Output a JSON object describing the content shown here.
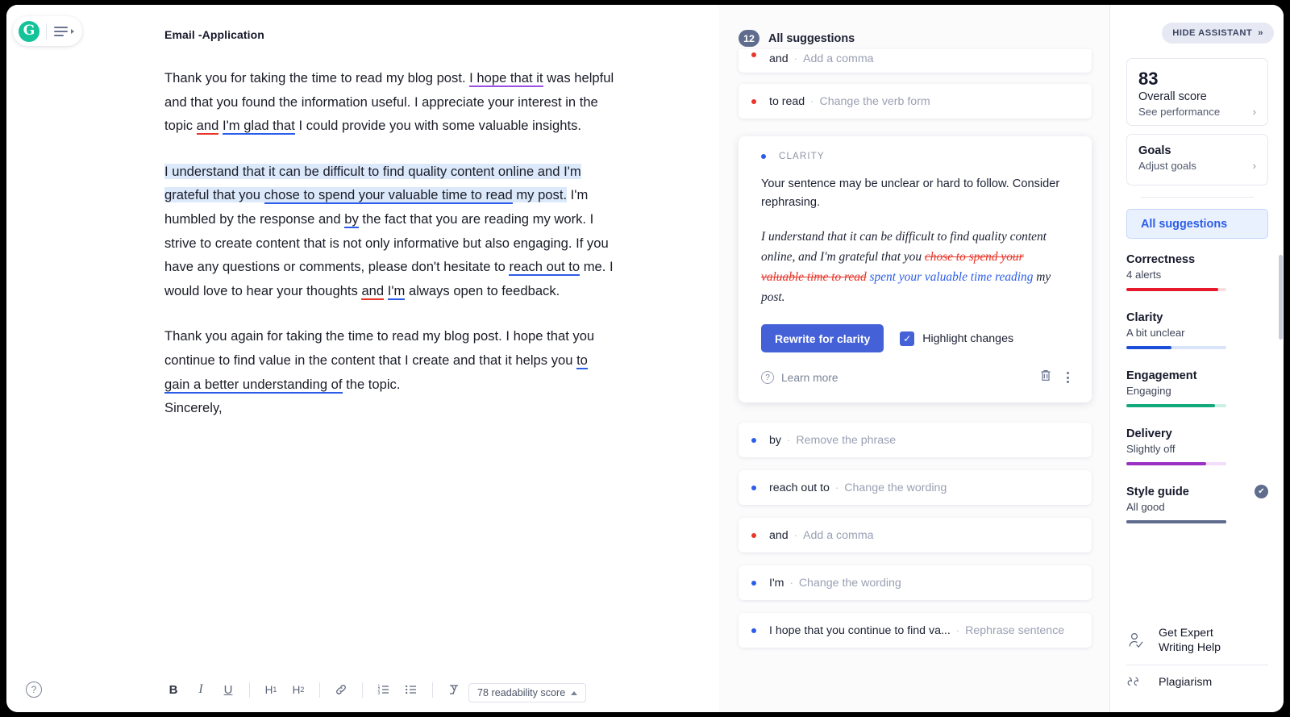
{
  "app": {
    "logo_letter": "G",
    "menu_icon": "hamburger-icon"
  },
  "document": {
    "title": "Email -Application",
    "paragraphs": [
      "Thank you for taking the time to read my blog post. I hope that it was helpful and that you found the information useful. I appreciate your interest in the topic and I'm glad that I could provide you with some valuable insights.",
      "I understand that it can be difficult to find quality content online and I'm grateful that you chose to spend your valuable time to read my post. I'm humbled by the response and by the fact that you are reading my work. I strive to create content that is not only informative but also engaging. If you have any questions or comments, please don't hesitate to reach out to me. I would love to hear your thoughts and I'm always open to feedback.",
      "Thank you again for taking the time to read my blog post. I hope that you continue to find value in the content that I create and that it helps you to gain a better understanding of the topic.",
      "Sincerely,"
    ]
  },
  "toolbar": {
    "bold": "B",
    "italic": "I",
    "underline": "U",
    "h1": "H",
    "h1_sub": "1",
    "h2": "H",
    "h2_sub": "2",
    "link_icon": "link-icon",
    "ordered_list_icon": "ordered-list-icon",
    "bullet_list_icon": "bullet-list-icon",
    "clear_format_icon": "clear-formatting-icon",
    "readability": "78 readability score",
    "help_icon": "?"
  },
  "suggestions": {
    "count": "12",
    "title": "All suggestions",
    "items": [
      {
        "target": "and",
        "sep": "·",
        "action": "Add a comma",
        "severity": "red",
        "clipped": true
      },
      {
        "target": "to read",
        "sep": "·",
        "action": "Change the verb form",
        "severity": "red",
        "clipped": false
      },
      {
        "target": "by",
        "sep": "·",
        "action": "Remove the phrase",
        "severity": "blue",
        "clipped": false
      },
      {
        "target": "reach out to",
        "sep": "·",
        "action": "Change the wording",
        "severity": "blue",
        "clipped": false
      },
      {
        "target": "and",
        "sep": "·",
        "action": "Add a comma",
        "severity": "red",
        "clipped": false
      },
      {
        "target": "I'm",
        "sep": "·",
        "action": "Change the wording",
        "severity": "blue",
        "clipped": false
      },
      {
        "target": "I hope that you continue to find va...",
        "sep": "·",
        "action": "Rephrase sentence",
        "severity": "blue",
        "clipped": false
      }
    ]
  },
  "clarity_card": {
    "category": "CLARITY",
    "description": "Your sentence may be unclear or hard to follow. Consider rephrasing.",
    "preview_before": "I understand that it can be difficult to find quality content online, and I'm grateful that you ",
    "preview_strike": "chose to spend your valuable time to read",
    "preview_insert": "spent your valuable time reading",
    "preview_after": " my post.",
    "primary_button": "Rewrite for clarity",
    "checkbox_label": "Highlight changes",
    "checkbox_checked": true,
    "learn_more": "Learn more",
    "delete_icon": "trash-icon",
    "more_icon": "kebab-menu-icon"
  },
  "assistant": {
    "hide_button": "HIDE ASSISTANT",
    "hide_button_icon": "chevron-double-right-icon",
    "score": {
      "value": "83",
      "label": "Overall score",
      "link": "See performance",
      "chevron": "›"
    },
    "goals": {
      "title": "Goals",
      "link": "Adjust goals",
      "chevron": "›"
    },
    "all_suggestions_tab": "All suggestions",
    "metrics": [
      {
        "name": "Correctness",
        "value": "4 alerts",
        "color": "#e8192c",
        "track": "#fbdde0",
        "fill_pct": 92
      },
      {
        "name": "Clarity",
        "value": "A bit unclear",
        "color": "#1d4ed8",
        "track": "#d9e4fb",
        "fill_pct": 45
      },
      {
        "name": "Engagement",
        "value": "Engaging",
        "color": "#14a97c",
        "track": "#c9f0e2",
        "fill_pct": 89
      },
      {
        "name": "Delivery",
        "value": "Slightly off",
        "color": "#9b30c4",
        "track": "#f3dcfa",
        "fill_pct": 80
      },
      {
        "name": "Style guide",
        "value": "All good",
        "color": "#5f6c8d",
        "track": "#5f6c8d",
        "fill_pct": 100,
        "badge": "✔"
      }
    ],
    "footer": [
      {
        "label": "Get Expert\nWriting Help",
        "icon": "expert-writer-icon"
      },
      {
        "label": "Plagiarism",
        "icon": "quote-marks-icon"
      }
    ]
  }
}
